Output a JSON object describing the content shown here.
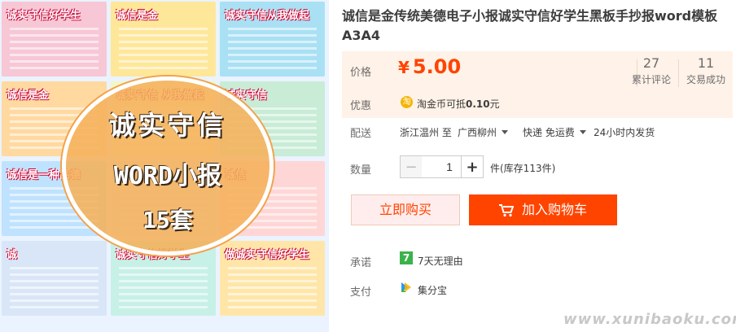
{
  "product": {
    "title": "诚信是金传统美德电子小报诚实守信好学生黑板手抄报word模板A3A4"
  },
  "gallery": {
    "tiles": [
      {
        "title": "诚实守信好学生",
        "color": "#f7c7d6"
      },
      {
        "title": "诚信是金",
        "color": "#ffe79a"
      },
      {
        "title": "诚实守信从我做起",
        "color": "#a9e0f4"
      },
      {
        "title": "诚信是金",
        "color": "#ffd9a0"
      },
      {
        "title": "诚实守信 从我做起",
        "color": "#f2f7c6"
      },
      {
        "title": "诚实守信",
        "color": "#c8ecd6"
      },
      {
        "title": "诚信是一种品德",
        "color": "#bfe2ff"
      },
      {
        "title": "",
        "color": "#ddeeff"
      },
      {
        "title": "诚信",
        "color": "#ffd6d6"
      },
      {
        "title": "诚",
        "color": "#d8e6f7"
      },
      {
        "title": "诚实守信好学生",
        "color": "#c7f0e6"
      },
      {
        "title": "做诚实守信好学生",
        "color": "#ffe6a8"
      }
    ],
    "badge": {
      "line1": "诚实守信",
      "line2": "WORD小报",
      "line3": "15套"
    }
  },
  "price": {
    "label": "价格",
    "currency": "¥",
    "amount": "5.00",
    "reviews_count": "27",
    "reviews_label": "累计评论",
    "trades_count": "11",
    "trades_label": "交易成功"
  },
  "discount": {
    "label": "优惠",
    "icon": "taobao-coin-icon",
    "text_prefix": "淘金币可抵",
    "text_amount": "0.10",
    "text_suffix": "元"
  },
  "shipping": {
    "label": "配送",
    "from": "浙江温州 至",
    "to": "广西柳州",
    "method": "快递 免运费",
    "dispatch": "24小时内发货"
  },
  "quantity": {
    "label": "数量",
    "value": "1",
    "minus": "−",
    "plus": "+",
    "stock": "件(库存113件)"
  },
  "actions": {
    "buy_label": "立即购买",
    "cart_label": "加入购物车"
  },
  "services": {
    "promise_label": "承诺",
    "promise_icon_text": "7",
    "promise_text": "7天无理由",
    "pay_label": "支付",
    "pay_text": "集分宝"
  },
  "watermark": "www.xunibaoku.com",
  "colors": {
    "accent": "#ff4400",
    "price_bg": "#fff2e8",
    "buy_bg": "#ffeded"
  }
}
